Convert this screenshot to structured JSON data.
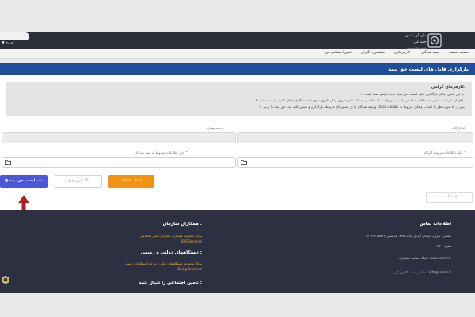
{
  "header": {
    "org_name": "سازمان تامین اجتماعی",
    "org_name_en": "Social Security Organization",
    "logout_label": "خروج"
  },
  "nav": {
    "items": [
      "صفحه نخست",
      "بیمه شدگان",
      "کارفرمایان",
      "مستمری بگیران",
      "تامین اجتماعی من"
    ]
  },
  "page": {
    "title": "بارگزاری فایل های لیست حق بیمه"
  },
  "notice": {
    "heading": "کارفرمای گرامی:",
    "lines": [
      "۱. در این بخش امکان بارگذاری فایل لیست حق بیمه جدید فراهم شده است.",
      "۲. برای ارسال لیست حق بیمه ماهانه ابتدا می بایست درخواست استفاده از خدمات غیرحضوری را از طریق منوی خدمات کارفرمایان تکمیل و ثبت نمائید.",
      "۳. پس از کد مورد نظر را انتخاب و فایل مربوط به اطلاعات کارگاه و بیمه شدگان را در مسیرهای مربوطه بارگذاری و سپس کلید ثبت حق بیمه را بزنید."
    ]
  },
  "form": {
    "workshop_code_label": "کد کارگاه",
    "row_label": "ردیف پیمان",
    "insured_file_label": "فایل اطلاعات مربوط به بیمه شدگان *",
    "workshop_file_label": "فایل اطلاعات مربوط کارگاه *"
  },
  "buttons": {
    "submit": "ثبت لیست حق بیمه",
    "clear": "پاک کردن فرم",
    "select_workshop": "انتخاب کارگاه",
    "back": "بازگشت"
  },
  "footer": {
    "contact_title": "اطلاعات تماس",
    "address": "نشانی: تهران، خیابان آزادی، پلاک ۳۶۵، کدپستی ۱۳۱۴۷۳۶۵۸۶۴",
    "phone": "تلفن: ۱۴۲۰",
    "website": "پایگاه سایت سازمان: www.tamin.ir",
    "email": "نشانی پست الکترونیکی: info@tamin.ir",
    "partners_title": "همکاران سازمان :",
    "partner1": "پرتال مجموعه همکاران سازمان تامین اجتماعی",
    "partner1_sub": "B2E Services",
    "gov_title": "دستگاههای دولتی و رسمی :",
    "gov1": "پرتال مجموعه دستگاههای دولتی و مرجع استعلامات رسمی",
    "gov1_sub": "Doing Business",
    "follow_title": "تامین اجتماعی را دنبال کنید :"
  },
  "colors": {
    "title_band": "#1f4f9a",
    "submit_button": "#4a57d8",
    "workshop_button": "#f2920f",
    "footer_bg": "#2c3040",
    "arrow": "#b01f1f"
  }
}
